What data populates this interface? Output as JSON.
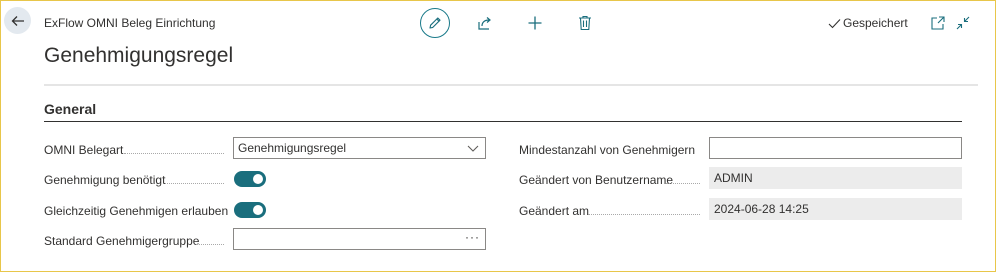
{
  "header": {
    "app_title": "ExFlow OMNI Beleg Einrichtung",
    "page_title": "Genehmigungsregel",
    "saved_status": "Gespeichert"
  },
  "icons": {
    "back": "arrow-left-icon",
    "edit": "pencil-icon",
    "share": "share-icon",
    "add": "plus-icon",
    "delete": "trash-icon",
    "saved": "checkmark-icon",
    "open_new": "open-in-new-window-icon",
    "collapse": "collapse-icon"
  },
  "colors": {
    "accent": "#1a6e7d",
    "frame_border": "#e8c64a",
    "readonly_bg": "#ececec"
  },
  "general": {
    "section_title": "General",
    "left_fields": [
      {
        "label": "OMNI Belegart",
        "value": "Genehmigungsregel",
        "type": "select"
      },
      {
        "label": "Genehmigung benötigt",
        "value": "on",
        "type": "toggle"
      },
      {
        "label": "Gleichzeitig Genehmigen erlauben",
        "value": "on",
        "type": "toggle"
      },
      {
        "label": "Standard Genehmigergruppe",
        "value": "",
        "type": "lookup"
      }
    ],
    "right_fields": [
      {
        "label": "Mindestanzahl von Genehmigern",
        "value": "",
        "type": "input"
      },
      {
        "label": "Geändert von Benutzername",
        "value": "ADMIN",
        "type": "readonly"
      },
      {
        "label": "Geändert am",
        "value": "2024-06-28 14:25",
        "type": "readonly"
      }
    ],
    "lookup_ellipsis": "···"
  }
}
